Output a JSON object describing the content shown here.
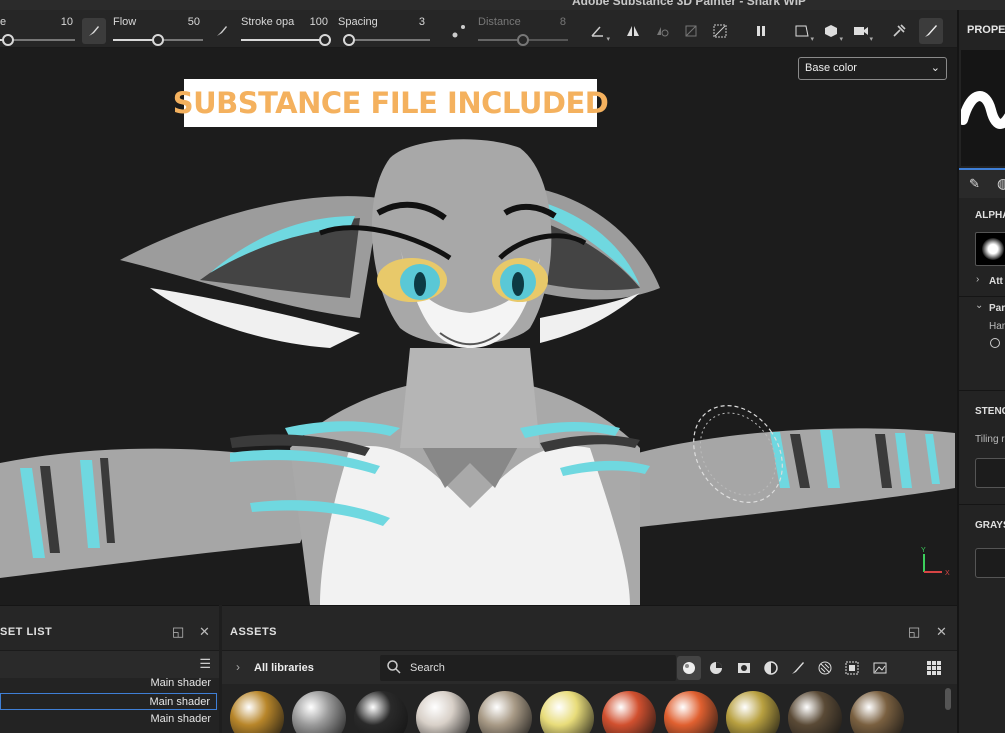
{
  "window": {
    "title": "Adobe Substance 3D Painter - Shark WIP"
  },
  "toolbar": {
    "size": {
      "label": "e",
      "value": "10",
      "fill": 0.1
    },
    "flow": {
      "label": "Flow",
      "value": "50",
      "fill": 0.5
    },
    "stroke_opacity": {
      "label": "Stroke opa",
      "value": "100",
      "fill": 1.0
    },
    "spacing": {
      "label": "Spacing",
      "value": "3",
      "fill": 0.03
    },
    "distance": {
      "label": "Distance",
      "value": "8",
      "fill": 0.5
    }
  },
  "viewport": {
    "banner_text": "SUBSTANCE FILE INCLUDED",
    "channel_select": "Base color",
    "axis_y": "Y",
    "axis_x": "X"
  },
  "texture_set_list": {
    "title": "SET LIST",
    "rows": [
      {
        "shader": "Main shader",
        "selected": false
      },
      {
        "shader": "Main shader",
        "selected": true
      },
      {
        "shader": "Main shader",
        "selected": false
      }
    ]
  },
  "assets": {
    "title": "ASSETS",
    "library": "All libraries",
    "search_placeholder": "Search",
    "filters": [
      "materials-filter-icon",
      "smart-materials-filter-icon",
      "textures-filter-icon",
      "masks-filter-icon",
      "brushes-filter-icon",
      "alphas-filter-icon",
      "grunges-filter-icon",
      "environment-filter-icon"
    ],
    "grid_icon": "grid-view-icon",
    "materials": [
      {
        "name": "bronze-material",
        "color": "#b8862a"
      },
      {
        "name": "chrome-material",
        "color": "#9a9a9a"
      },
      {
        "name": "black-plastic-material",
        "color": "#2a2a2a"
      },
      {
        "name": "leaf-material",
        "color": "#d8d0c8"
      },
      {
        "name": "stone-material",
        "color": "#a89a86"
      },
      {
        "name": "yellow-paint-material",
        "color": "#e8dc7a"
      },
      {
        "name": "red-rubber-material",
        "color": "#d1502f"
      },
      {
        "name": "orange-paint-material",
        "color": "#e06030"
      },
      {
        "name": "gold-material",
        "color": "#b8a040"
      },
      {
        "name": "bark-material",
        "color": "#5a4a36"
      },
      {
        "name": "wood-material",
        "color": "#7a6040"
      }
    ]
  },
  "properties": {
    "title": "PROPER",
    "alpha_section": "ALPHA",
    "attributes": "Att",
    "parameters": "Par",
    "hardness": "Har",
    "stencil_section": "STENC",
    "tiling": "Tiling r",
    "grayscale_section": "GRAYS"
  },
  "colors": {
    "accent": "#3f7fd6",
    "banner_text": "#f4b15e",
    "fur_cyan": "#6fd8e0"
  }
}
